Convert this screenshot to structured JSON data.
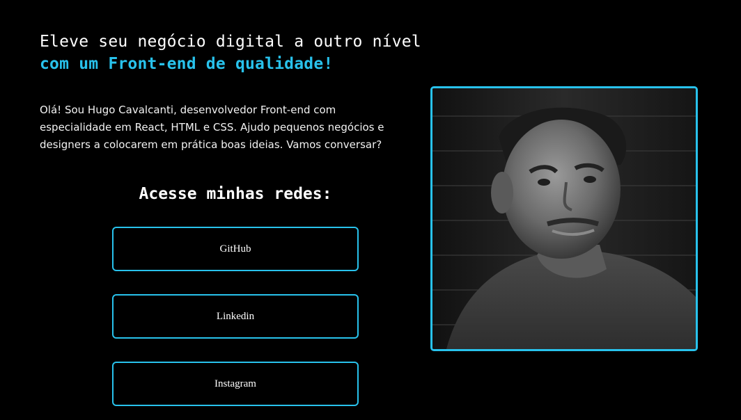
{
  "hero": {
    "headline_line1": "Eleve seu negócio digital a outro nível",
    "headline_line2": "com um Front-end de qualidade!",
    "intro_line1": "Olá! Sou Hugo Cavalcanti, desenvolvedor Front-end com",
    "intro_line2": "especialidade em React, HTML e CSS. Ajudo pequenos negócios e",
    "intro_line3": "designers a colocarem em prática boas ideias. Vamos conversar?"
  },
  "socials": {
    "title": "Acesse minhas redes:",
    "buttons": [
      {
        "label": "GitHub"
      },
      {
        "label": "Linkedin"
      },
      {
        "label": "Instagram"
      }
    ]
  },
  "colors": {
    "background": "#000000",
    "accent": "#28c2ec",
    "text": "#ffffff"
  },
  "icons": {
    "portrait": "profile-photo"
  }
}
